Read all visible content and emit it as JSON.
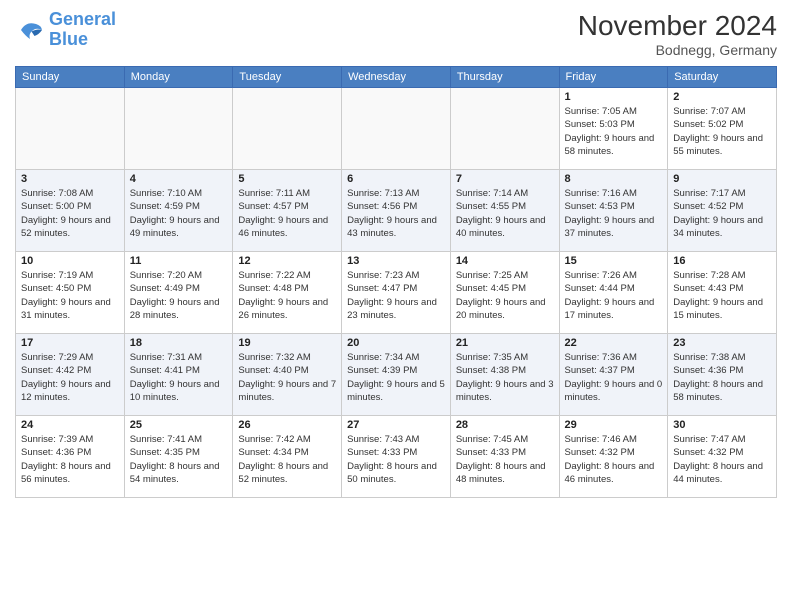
{
  "header": {
    "logo_line1": "General",
    "logo_line2": "Blue",
    "month_title": "November 2024",
    "location": "Bodnegg, Germany"
  },
  "days_of_week": [
    "Sunday",
    "Monday",
    "Tuesday",
    "Wednesday",
    "Thursday",
    "Friday",
    "Saturday"
  ],
  "weeks": [
    [
      {
        "num": "",
        "info": ""
      },
      {
        "num": "",
        "info": ""
      },
      {
        "num": "",
        "info": ""
      },
      {
        "num": "",
        "info": ""
      },
      {
        "num": "",
        "info": ""
      },
      {
        "num": "1",
        "info": "Sunrise: 7:05 AM\nSunset: 5:03 PM\nDaylight: 9 hours and 58 minutes."
      },
      {
        "num": "2",
        "info": "Sunrise: 7:07 AM\nSunset: 5:02 PM\nDaylight: 9 hours and 55 minutes."
      }
    ],
    [
      {
        "num": "3",
        "info": "Sunrise: 7:08 AM\nSunset: 5:00 PM\nDaylight: 9 hours and 52 minutes."
      },
      {
        "num": "4",
        "info": "Sunrise: 7:10 AM\nSunset: 4:59 PM\nDaylight: 9 hours and 49 minutes."
      },
      {
        "num": "5",
        "info": "Sunrise: 7:11 AM\nSunset: 4:57 PM\nDaylight: 9 hours and 46 minutes."
      },
      {
        "num": "6",
        "info": "Sunrise: 7:13 AM\nSunset: 4:56 PM\nDaylight: 9 hours and 43 minutes."
      },
      {
        "num": "7",
        "info": "Sunrise: 7:14 AM\nSunset: 4:55 PM\nDaylight: 9 hours and 40 minutes."
      },
      {
        "num": "8",
        "info": "Sunrise: 7:16 AM\nSunset: 4:53 PM\nDaylight: 9 hours and 37 minutes."
      },
      {
        "num": "9",
        "info": "Sunrise: 7:17 AM\nSunset: 4:52 PM\nDaylight: 9 hours and 34 minutes."
      }
    ],
    [
      {
        "num": "10",
        "info": "Sunrise: 7:19 AM\nSunset: 4:50 PM\nDaylight: 9 hours and 31 minutes."
      },
      {
        "num": "11",
        "info": "Sunrise: 7:20 AM\nSunset: 4:49 PM\nDaylight: 9 hours and 28 minutes."
      },
      {
        "num": "12",
        "info": "Sunrise: 7:22 AM\nSunset: 4:48 PM\nDaylight: 9 hours and 26 minutes."
      },
      {
        "num": "13",
        "info": "Sunrise: 7:23 AM\nSunset: 4:47 PM\nDaylight: 9 hours and 23 minutes."
      },
      {
        "num": "14",
        "info": "Sunrise: 7:25 AM\nSunset: 4:45 PM\nDaylight: 9 hours and 20 minutes."
      },
      {
        "num": "15",
        "info": "Sunrise: 7:26 AM\nSunset: 4:44 PM\nDaylight: 9 hours and 17 minutes."
      },
      {
        "num": "16",
        "info": "Sunrise: 7:28 AM\nSunset: 4:43 PM\nDaylight: 9 hours and 15 minutes."
      }
    ],
    [
      {
        "num": "17",
        "info": "Sunrise: 7:29 AM\nSunset: 4:42 PM\nDaylight: 9 hours and 12 minutes."
      },
      {
        "num": "18",
        "info": "Sunrise: 7:31 AM\nSunset: 4:41 PM\nDaylight: 9 hours and 10 minutes."
      },
      {
        "num": "19",
        "info": "Sunrise: 7:32 AM\nSunset: 4:40 PM\nDaylight: 9 hours and 7 minutes."
      },
      {
        "num": "20",
        "info": "Sunrise: 7:34 AM\nSunset: 4:39 PM\nDaylight: 9 hours and 5 minutes."
      },
      {
        "num": "21",
        "info": "Sunrise: 7:35 AM\nSunset: 4:38 PM\nDaylight: 9 hours and 3 minutes."
      },
      {
        "num": "22",
        "info": "Sunrise: 7:36 AM\nSunset: 4:37 PM\nDaylight: 9 hours and 0 minutes."
      },
      {
        "num": "23",
        "info": "Sunrise: 7:38 AM\nSunset: 4:36 PM\nDaylight: 8 hours and 58 minutes."
      }
    ],
    [
      {
        "num": "24",
        "info": "Sunrise: 7:39 AM\nSunset: 4:36 PM\nDaylight: 8 hours and 56 minutes."
      },
      {
        "num": "25",
        "info": "Sunrise: 7:41 AM\nSunset: 4:35 PM\nDaylight: 8 hours and 54 minutes."
      },
      {
        "num": "26",
        "info": "Sunrise: 7:42 AM\nSunset: 4:34 PM\nDaylight: 8 hours and 52 minutes."
      },
      {
        "num": "27",
        "info": "Sunrise: 7:43 AM\nSunset: 4:33 PM\nDaylight: 8 hours and 50 minutes."
      },
      {
        "num": "28",
        "info": "Sunrise: 7:45 AM\nSunset: 4:33 PM\nDaylight: 8 hours and 48 minutes."
      },
      {
        "num": "29",
        "info": "Sunrise: 7:46 AM\nSunset: 4:32 PM\nDaylight: 8 hours and 46 minutes."
      },
      {
        "num": "30",
        "info": "Sunrise: 7:47 AM\nSunset: 4:32 PM\nDaylight: 8 hours and 44 minutes."
      }
    ]
  ]
}
